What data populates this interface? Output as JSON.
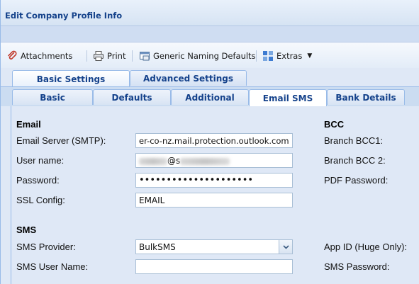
{
  "window": {
    "title": "Edit Company Profile Info"
  },
  "toolbar": {
    "attachments": "Attachments",
    "print": "Print",
    "generic_naming": "Generic Naming Defaults",
    "extras": "Extras"
  },
  "tabs_primary": [
    "Basic Settings",
    "Advanced Settings"
  ],
  "tabs_secondary": [
    "Basic",
    "Defaults",
    "Additional",
    "Email SMS",
    "Bank Details"
  ],
  "active_secondary_tab": "Email SMS",
  "email": {
    "heading": "Email",
    "server_label": "Email Server (SMTP):",
    "server_value": "er-co-nz.mail.protection.outlook.com",
    "username_label": "User name:",
    "username_value_visible": "@s",
    "password_label": "Password:",
    "password_value": "•••••••••••••••••••••",
    "ssl_label": "SSL Config:",
    "ssl_value": "EMAIL"
  },
  "bcc": {
    "heading": "BCC",
    "branch_bcc1_label": "Branch BCC1:",
    "branch_bcc2_label": "Branch BCC 2:",
    "pdf_password_label": "PDF Password:"
  },
  "sms": {
    "heading": "SMS",
    "provider_label": "SMS Provider:",
    "provider_value": "BulkSMS",
    "username_label": "SMS User Name:",
    "username_value": "",
    "app_id_label": "App ID (Huge Only):",
    "password_label": "SMS Password:"
  },
  "colors": {
    "panel_bg": "#dfe8f6",
    "tab_text": "#15428b",
    "border": "#99bbe8"
  }
}
